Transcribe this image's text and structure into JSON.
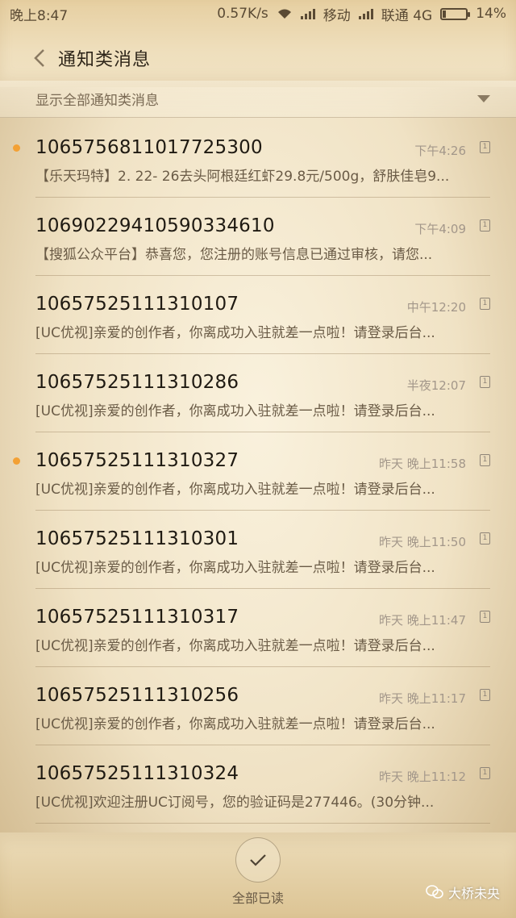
{
  "status_bar": {
    "time": "晚上8:47",
    "speed": "0.57K/s",
    "carrier1": "移动",
    "carrier2": "联通 4G",
    "battery": "14%",
    "battery_level": 0.14
  },
  "header": {
    "title": "通知类消息"
  },
  "filter": {
    "label": "显示全部通知类消息"
  },
  "messages": [
    {
      "sender": "1065756811017725300",
      "time": "下午4:26",
      "preview": "【乐天玛特】2. 22- 26去头阿根廷红虾29.8元/500g，舒肤佳皂9...",
      "unread": true,
      "sim": "1"
    },
    {
      "sender": "10690229410590334610",
      "time": "下午4:09",
      "preview": "【搜狐公众平台】恭喜您，您注册的账号信息已通过审核，请您...",
      "unread": false,
      "sim": "1"
    },
    {
      "sender": "10657525111310107",
      "time": "中午12:20",
      "preview": "[UC优视]亲爱的创作者，你离成功入驻就差一点啦！请登录后台...",
      "unread": false,
      "sim": "1"
    },
    {
      "sender": "10657525111310286",
      "time": "半夜12:07",
      "preview": "[UC优视]亲爱的创作者，你离成功入驻就差一点啦！请登录后台...",
      "unread": false,
      "sim": "1"
    },
    {
      "sender": "10657525111310327",
      "time": "昨天 晚上11:58",
      "preview": "[UC优视]亲爱的创作者，你离成功入驻就差一点啦！请登录后台...",
      "unread": true,
      "sim": "1"
    },
    {
      "sender": "10657525111310301",
      "time": "昨天 晚上11:50",
      "preview": "[UC优视]亲爱的创作者，你离成功入驻就差一点啦！请登录后台...",
      "unread": false,
      "sim": "1"
    },
    {
      "sender": "10657525111310317",
      "time": "昨天 晚上11:47",
      "preview": "[UC优视]亲爱的创作者，你离成功入驻就差一点啦！请登录后台...",
      "unread": false,
      "sim": "1"
    },
    {
      "sender": "10657525111310256",
      "time": "昨天 晚上11:17",
      "preview": "[UC优视]亲爱的创作者，你离成功入驻就差一点啦！请登录后台...",
      "unread": false,
      "sim": "1"
    },
    {
      "sender": "10657525111310324",
      "time": "昨天 晚上11:12",
      "preview": "[UC优视]欢迎注册UC订阅号，您的验证码是277446。(30分钟...",
      "unread": false,
      "sim": "1"
    }
  ],
  "footer": {
    "mark_all_read": "全部已读"
  },
  "watermark": {
    "text": "大桥未央"
  },
  "colors": {
    "unread_dot": "#f3a135",
    "background": "#f2e6cc"
  }
}
